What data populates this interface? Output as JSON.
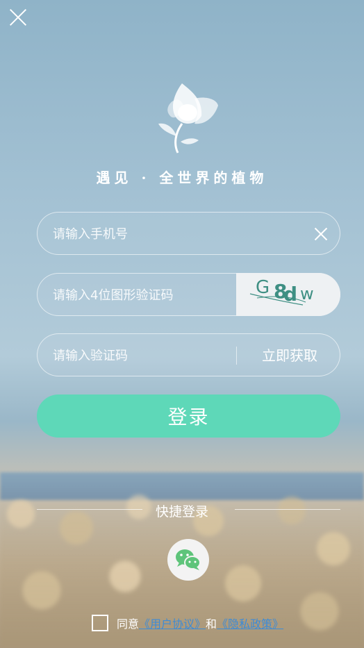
{
  "slogan": "遇见 · 全世界的植物",
  "phone": {
    "placeholder": "请输入手机号"
  },
  "captcha": {
    "placeholder": "请输入4位图形验证码",
    "code": [
      "G",
      "8",
      "d",
      "w"
    ]
  },
  "sms": {
    "placeholder": "请输入验证码",
    "get_code_label": "立即获取"
  },
  "login_label": "登录",
  "quick_login_label": "快捷登录",
  "agreement": {
    "prefix": "同意",
    "user_agreement": "《用户协议》",
    "connector": "和",
    "privacy_policy": "《隐私政策》"
  },
  "colors": {
    "primary": "#5ed8b8",
    "link": "#3d8bd6",
    "wechat": "#5ec47a"
  },
  "icons": {
    "close": "close-icon",
    "clear": "clear-icon",
    "wechat": "wechat-icon",
    "logo": "flower-logo"
  }
}
